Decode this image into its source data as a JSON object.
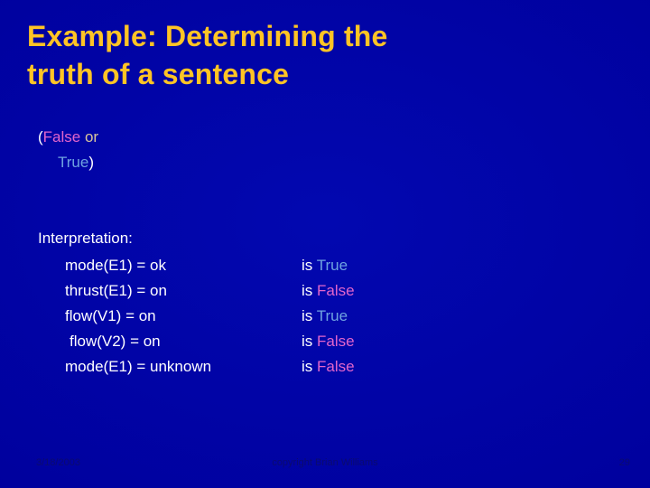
{
  "slide": {
    "background_color": "#0000A4",
    "title": {
      "line1": "Example: Determining the",
      "line2": "truth of a sentence",
      "color": "#FFC425"
    },
    "expression": {
      "open_paren": "(",
      "false_token": "False",
      "or_token": " or",
      "true_token": "True",
      "close_paren": ")",
      "colors": {
        "paren": "#FFFFFF",
        "false": "#E265CB",
        "true": "#6FA3E0",
        "or": "#D9C59C"
      }
    },
    "interpretation": {
      "heading": "Interpretation:",
      "is_word": "is",
      "rows": [
        {
          "assignment": "mode(E1) = ok",
          "is_word": "is",
          "value": "True",
          "value_color": "#6FA3E0",
          "extra_indent": false
        },
        {
          "assignment": "thrust(E1) = on",
          "is_word": "is",
          "value": "False",
          "value_color": "#E265CB",
          "extra_indent": false
        },
        {
          "assignment": "flow(V1) = on",
          "is_word": "is",
          "value": "True",
          "value_color": "#6FA3E0",
          "extra_indent": false
        },
        {
          "assignment": "flow(V2) = on",
          "is_word": "is",
          "value": "False",
          "value_color": "#E265CB",
          "extra_indent": true
        },
        {
          "assignment": "mode(E1) = unknown",
          "is_word": "is",
          "value": "False",
          "value_color": "#E265CB",
          "extra_indent": false
        }
      ]
    },
    "footer": {
      "date": "3/18/2003",
      "copyright": "copyright Brian Williams",
      "page_number": "29",
      "color": "#0B0B6E"
    }
  }
}
